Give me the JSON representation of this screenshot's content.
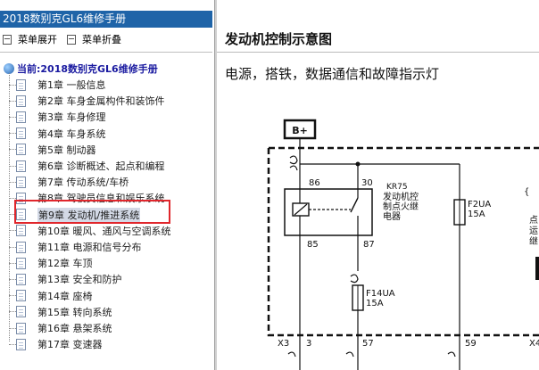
{
  "left_panel": {
    "title": "2018数别克GL6维修手册",
    "toolbar": {
      "expand_label": "菜单展开",
      "collapse_label": "菜单折叠"
    },
    "root_label": "当前:2018数别克GL6维修手册",
    "chapters": [
      "第1章 一般信息",
      "第2章 车身金属构件和装饰件",
      "第3章 车身修理",
      "第4章 车身系统",
      "第5章 制动器",
      "第6章 诊断概述、起点和编程",
      "第7章 传动系统/车桥",
      "第8章 驾驶员信息和娱乐系统",
      "第9章 发动机/推进系统",
      "第10章 暖风、通风与空调系统",
      "第11章 电源和信号分布",
      "第12章 车顶",
      "第13章 安全和防护",
      "第14章 座椅",
      "第15章 转向系统",
      "第16章 悬架系统",
      "第17章 变速器"
    ],
    "selected_index": 8,
    "colors": {
      "title_bg": "#1f64a8",
      "highlight": "#e0262c"
    }
  },
  "right_panel": {
    "title": "发动机控制示意图",
    "subtitle": "电源，搭铁，数据通信和故障指示灯",
    "diagram": {
      "power_label": "B+",
      "relay_id": "KR75",
      "relay_name_lines": [
        "发动机控",
        "制点火继",
        "电器"
      ],
      "pin_labels": [
        "86",
        "30",
        "85",
        "87"
      ],
      "fuse_f2": {
        "name": "F2UA",
        "rating": "15A"
      },
      "fuse_f14": {
        "name": "F14UA",
        "rating": "15A"
      },
      "connector_x3": "X3",
      "connector_x4": "X4",
      "bottom_pins": [
        "3",
        "57",
        "59"
      ],
      "right_edge_text": [
        "点",
        "运",
        "继"
      ]
    }
  }
}
